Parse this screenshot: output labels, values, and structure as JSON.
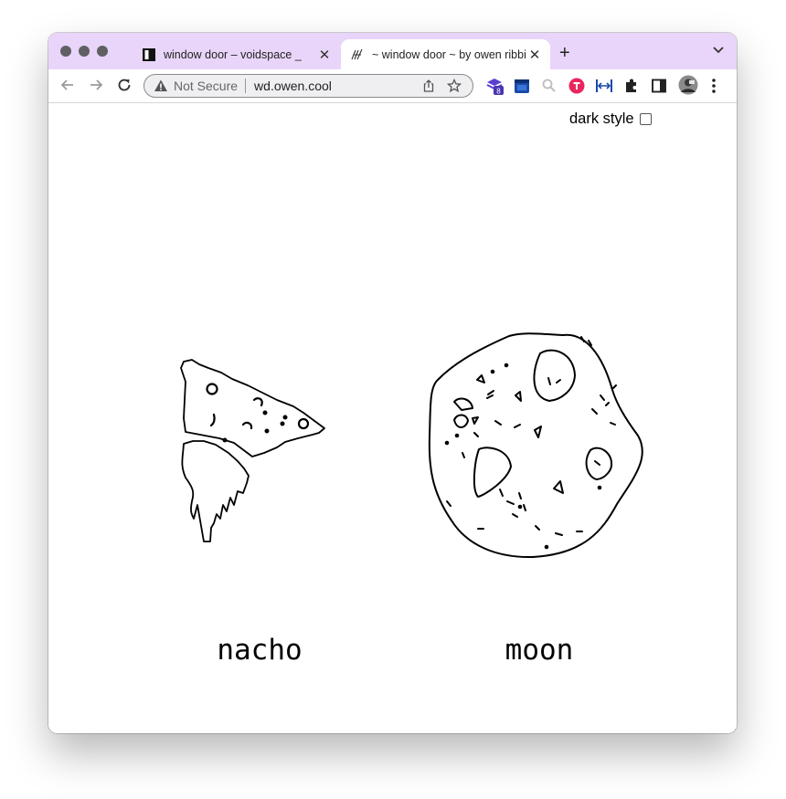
{
  "tabs": [
    {
      "title": "window door – voidspace _",
      "active": false
    },
    {
      "title": "~ window door ~ by owen ribbit",
      "active": true
    }
  ],
  "addressBar": {
    "securityText": "Not Secure",
    "url": "wd.owen.cool"
  },
  "extensions": {
    "badgeCount": "8"
  },
  "page": {
    "darkStyle": {
      "label": "dark style",
      "checked": false
    },
    "items": [
      {
        "caption": "nacho"
      },
      {
        "caption": "moon"
      }
    ]
  },
  "colors": {
    "tabBar": "#e9d5f9",
    "extensionPurple": "#5b3fd1",
    "extensionBlue": "#1a4aa8",
    "extensionPink": "#e8275f"
  }
}
